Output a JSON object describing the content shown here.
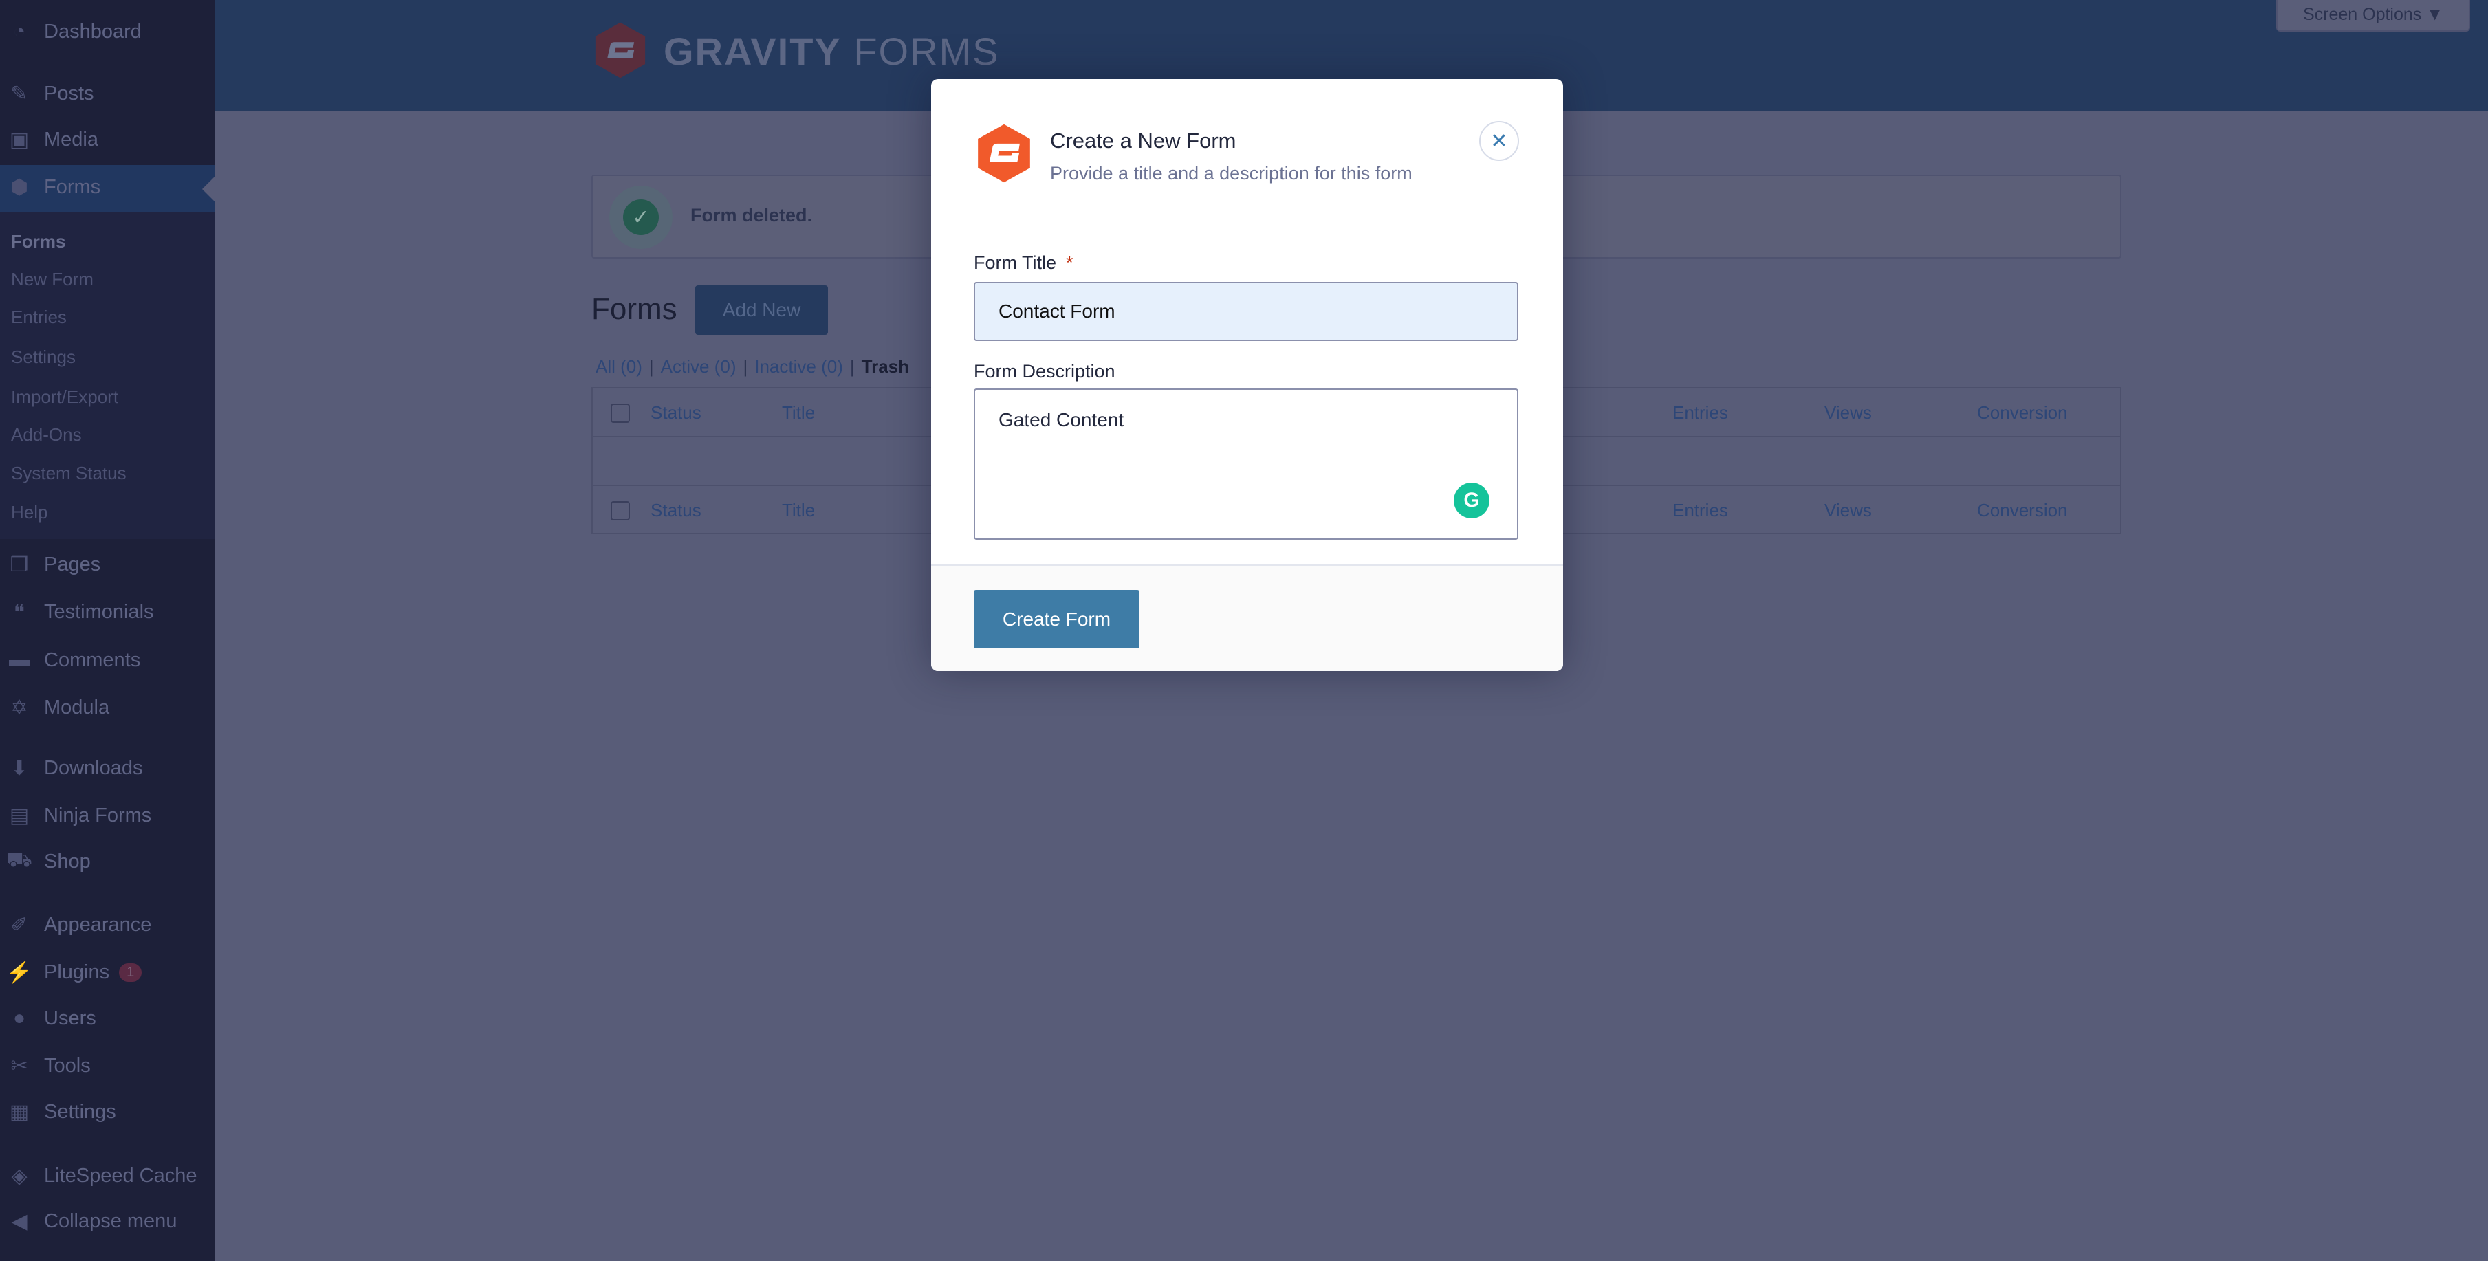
{
  "sidebar": {
    "items": [
      {
        "label": "Dashboard",
        "icon": "dashboard-icon",
        "glyph": "◔"
      },
      {
        "label": "Posts",
        "icon": "pin-icon",
        "glyph": "✎"
      },
      {
        "label": "Media",
        "icon": "media-icon",
        "glyph": "▣"
      },
      {
        "label": "Forms",
        "icon": "gravity-forms-icon",
        "glyph": "⬢"
      },
      {
        "label": "Pages",
        "icon": "pages-icon",
        "glyph": "❐"
      },
      {
        "label": "Testimonials",
        "icon": "quote-icon",
        "glyph": "❝"
      },
      {
        "label": "Comments",
        "icon": "comment-icon",
        "glyph": "▬"
      },
      {
        "label": "Modula",
        "icon": "modula-icon",
        "glyph": "✡"
      },
      {
        "label": "Downloads",
        "icon": "download-icon",
        "glyph": "⬇"
      },
      {
        "label": "Ninja Forms",
        "icon": "ninja-forms-icon",
        "glyph": "▤"
      },
      {
        "label": "Shop",
        "icon": "cart-icon",
        "glyph": "⛟"
      },
      {
        "label": "Appearance",
        "icon": "paintbrush-icon",
        "glyph": "✐"
      },
      {
        "label": "Plugins",
        "icon": "plugin-icon",
        "glyph": "⚡",
        "badge": "1"
      },
      {
        "label": "Users",
        "icon": "user-icon",
        "glyph": "●"
      },
      {
        "label": "Tools",
        "icon": "wrench-icon",
        "glyph": "✂"
      },
      {
        "label": "Settings",
        "icon": "settings-icon",
        "glyph": "▦"
      },
      {
        "label": "LiteSpeed Cache",
        "icon": "litespeed-icon",
        "glyph": "◈"
      },
      {
        "label": "Collapse menu",
        "icon": "collapse-icon",
        "glyph": "◀"
      }
    ],
    "submenu": [
      "Forms",
      "New Form",
      "Entries",
      "Settings",
      "Import/Export",
      "Add-Ons",
      "System Status",
      "Help"
    ]
  },
  "header": {
    "brand_bold": "GRAVITY",
    "brand_light": "FORMS",
    "screen_options": "Screen Options ▼"
  },
  "notice": {
    "text": "Form deleted."
  },
  "page": {
    "title": "Forms",
    "add_new": "Add New",
    "filters": [
      {
        "label": "All (0)"
      },
      {
        "label": "Active (0)"
      },
      {
        "label": "Inactive (0)"
      },
      {
        "label": "Trash"
      }
    ],
    "columns": [
      "Status",
      "Title",
      "Entries",
      "Views",
      "Conversion"
    ]
  },
  "modal": {
    "title": "Create a New Form",
    "subtitle": "Provide a title and a description for this form",
    "close": "✕",
    "form_title_label": "Form Title",
    "required_mark": "*",
    "form_title_value": "Contact Form",
    "form_description_label": "Form Description",
    "form_description_value": "Gated Content",
    "submit": "Create Form"
  },
  "colors": {
    "brand_orange": "#f15a2b",
    "primary_button": "#3e7ca6",
    "grammarly": "#15c39a",
    "required": "#c02b0a"
  }
}
